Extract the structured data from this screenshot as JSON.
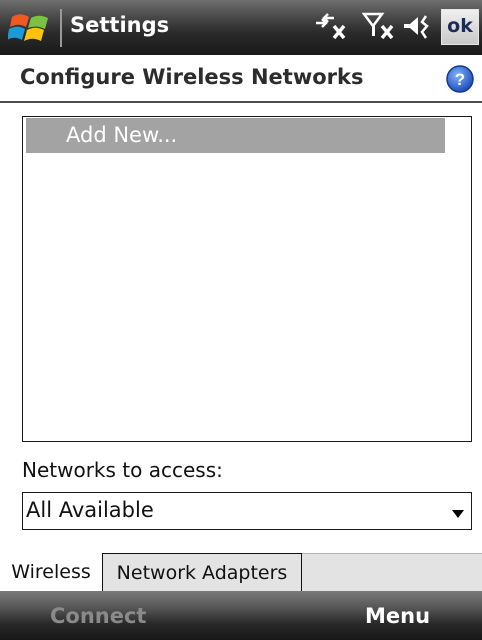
{
  "titlebar": {
    "title": "Settings",
    "ok_label": "ok",
    "icons": [
      "windows-start-icon",
      "connectivity-off-icon",
      "signal-off-icon",
      "volume-icon"
    ]
  },
  "header": {
    "title": "Configure Wireless Networks",
    "help_icon": "help-icon"
  },
  "networks_list": {
    "items": [
      {
        "label": "Add New...",
        "selected": true
      }
    ]
  },
  "access": {
    "label": "Networks to access:",
    "selected_value": "All Available"
  },
  "tabs": [
    {
      "label": "Wireless",
      "active": true
    },
    {
      "label": "Network Adapters",
      "active": false
    }
  ],
  "softkeys": {
    "left": "Connect",
    "left_enabled": false,
    "right": "Menu"
  },
  "colors": {
    "selection": "#a3a3a3",
    "help_blue": "#2a5fd0",
    "disabled_softkey": "#8a8a8a"
  }
}
